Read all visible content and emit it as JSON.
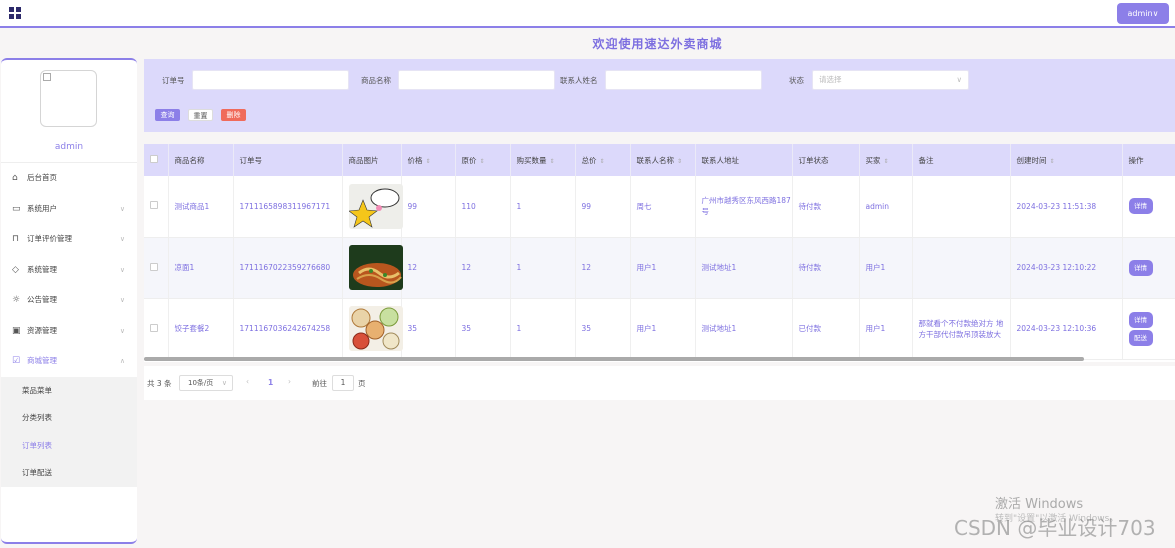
{
  "topbar": {
    "admin_button": "admin∨"
  },
  "header": {
    "welcome": "欢迎使用速达外卖商城"
  },
  "sidebar": {
    "username": "admin",
    "menu": [
      {
        "label": "后台首页",
        "icon": "home-icon"
      },
      {
        "label": "系统用户",
        "icon": "monitor-icon"
      },
      {
        "label": "订单评价管理",
        "icon": "bookmark-icon"
      },
      {
        "label": "系统管理",
        "icon": "tag-icon"
      },
      {
        "label": "公告管理",
        "icon": "sun-icon"
      },
      {
        "label": "资源管理",
        "icon": "inbox-icon"
      },
      {
        "label": "商城管理",
        "icon": "clipboard-icon"
      }
    ],
    "submenu": [
      "菜品菜单",
      "分类列表",
      "订单列表",
      "订单配送"
    ]
  },
  "search": {
    "order_no_label": "订单号",
    "product_name_label": "商品名称",
    "contact_name_label": "联系人姓名",
    "status_label": "状态",
    "status_placeholder": "请选择",
    "query_button": "查询",
    "reset_button": "重置",
    "delete_button": "删除"
  },
  "table": {
    "headers": [
      "商品名称",
      "订单号",
      "商品图片",
      "价格",
      "原价",
      "购买数量",
      "总价",
      "联系人名称",
      "联系人地址",
      "订单状态",
      "买家",
      "备注",
      "创建时间",
      "操作"
    ],
    "rows": [
      {
        "name": "测试商品1",
        "order_no": "1711165898311967171",
        "price": "99",
        "original_price": "110",
        "quantity": "1",
        "total": "99",
        "contact": "周七",
        "address": "广州市越秀区东风西路187号",
        "status": "待付款",
        "buyer": "admin",
        "remark": "",
        "created": "2024-03-23 11:51:38",
        "actions": [
          "详情"
        ]
      },
      {
        "name": "凉面1",
        "order_no": "1711167022359276680",
        "price": "12",
        "original_price": "12",
        "quantity": "1",
        "total": "12",
        "contact": "用户1",
        "address": "测试地址1",
        "status": "待付款",
        "buyer": "用户1",
        "remark": "",
        "created": "2024-03-23 12:10:22",
        "actions": [
          "详情"
        ]
      },
      {
        "name": "饺子套餐2",
        "order_no": "1711167036242674258",
        "price": "35",
        "original_price": "35",
        "quantity": "1",
        "total": "35",
        "contact": "用户1",
        "address": "测试地址1",
        "status": "已付款",
        "buyer": "用户1",
        "remark": "那就看个不付款绝对方 地方干部代付款吊顶装放大",
        "created": "2024-03-23 12:10:36",
        "actions": [
          "详情",
          "配送"
        ]
      }
    ]
  },
  "pagination": {
    "total": "共 3 条",
    "page_size": "10条/页",
    "prev": "‹",
    "current": "1",
    "next": "›",
    "goto": "前往",
    "goto_value": "1",
    "page_suffix": "页"
  },
  "watermarks": {
    "windows_line1": "激活 Windows",
    "windows_line2": "转到\"设置\"以激活 Windows。",
    "csdn": "CSDN @毕业设计703"
  }
}
